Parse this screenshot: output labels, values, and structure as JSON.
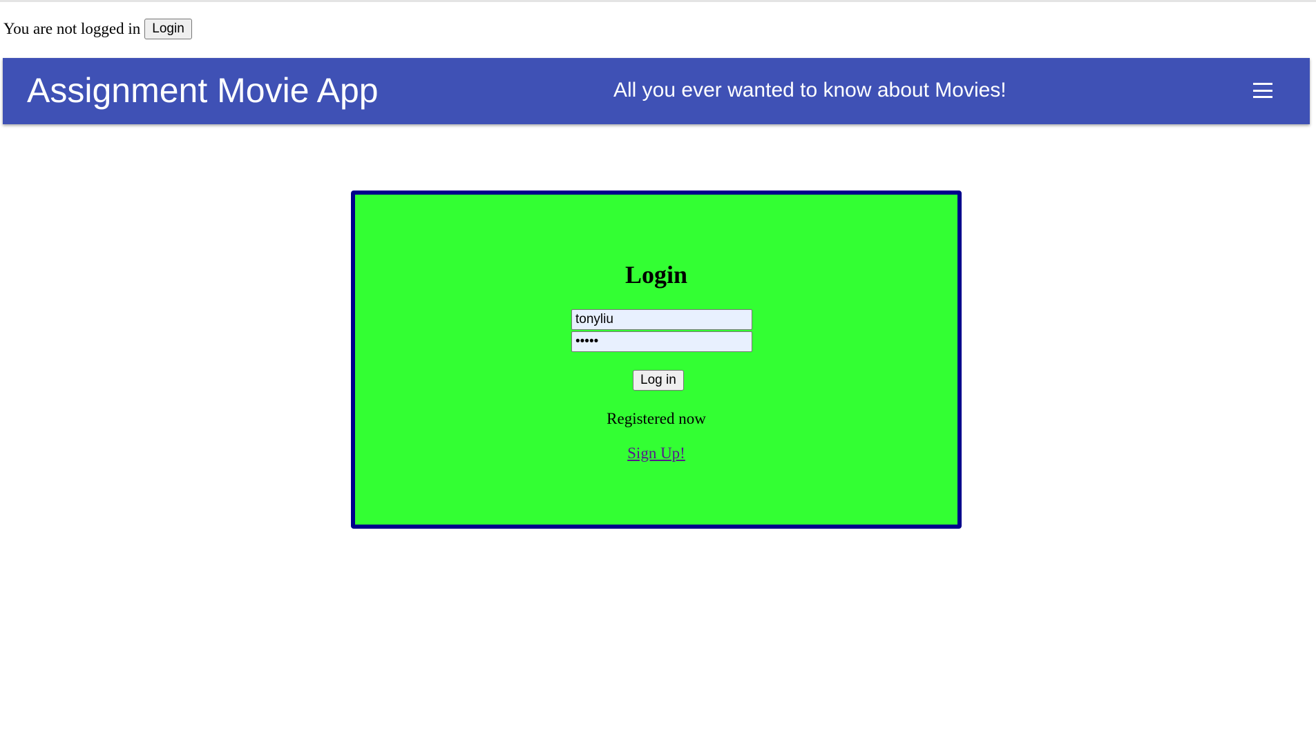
{
  "auth": {
    "status_text": "You are not logged in",
    "login_button": "Login"
  },
  "appbar": {
    "title": "Assignment Movie App",
    "tagline": "All you ever wanted to know about Movies!",
    "menu_icon": "hamburger-menu-icon",
    "background_color": "#3f51b5"
  },
  "login_form": {
    "heading": "Login",
    "username_value": "tonyliu",
    "password_value": "•••••",
    "submit_label": "Log in",
    "register_text": "Registered now",
    "signup_link": "Sign Up!",
    "card_background": "#33ff33",
    "card_border": "#00008b"
  }
}
